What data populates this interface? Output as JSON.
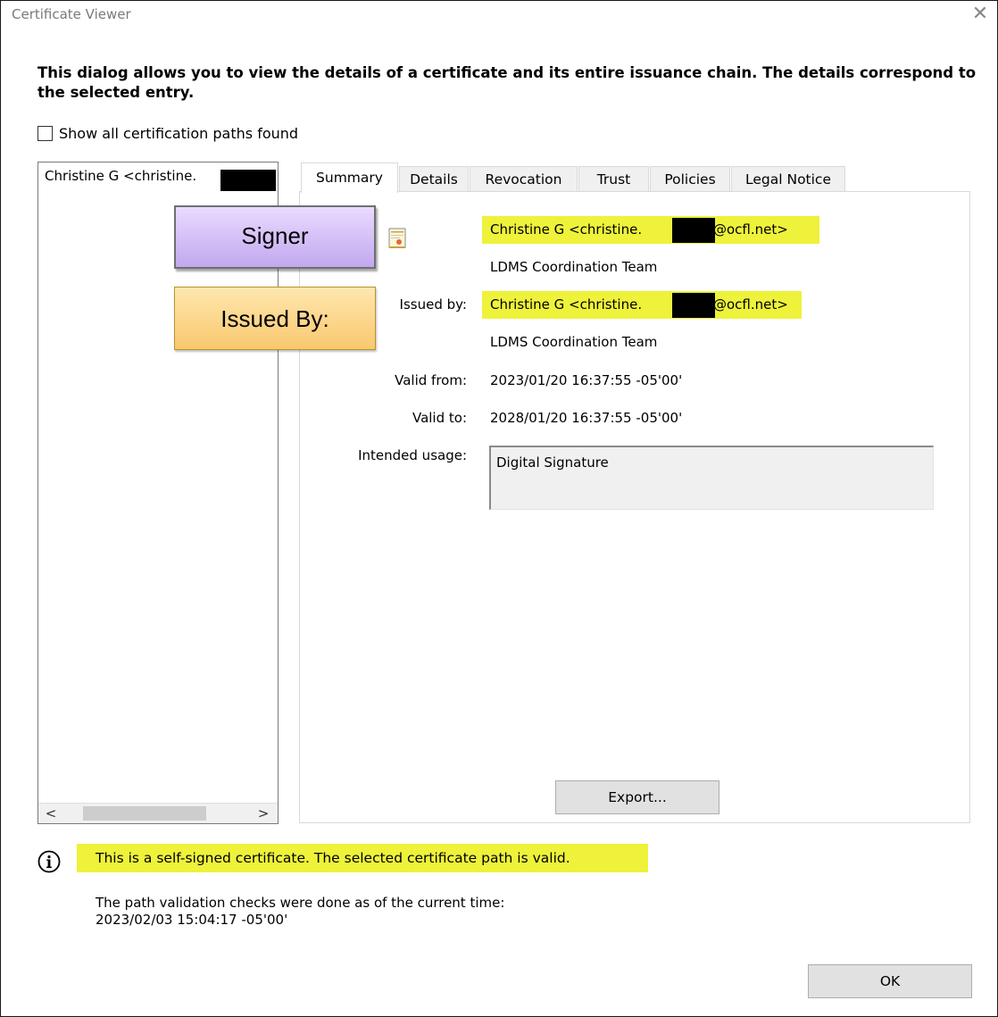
{
  "window": {
    "title": "Certificate Viewer",
    "close_glyph": "✕"
  },
  "intro": "This dialog allows you to view the details of a certificate and its entire issuance chain. The details correspond to the selected entry.",
  "show_all_paths": {
    "label": "Show all certification paths found",
    "checked": false
  },
  "chain": {
    "items": [
      {
        "label": "Christine G <christine."
      }
    ],
    "scroll_left": "<",
    "scroll_right": ">"
  },
  "tabs": [
    {
      "label": "Summary",
      "active": true
    },
    {
      "label": "Details",
      "active": false
    },
    {
      "label": "Revocation",
      "active": false
    },
    {
      "label": "Trust",
      "active": false
    },
    {
      "label": "Policies",
      "active": false
    },
    {
      "label": "Legal Notice",
      "active": false
    }
  ],
  "summary": {
    "subject_name_prefix": "Christine G <christine.",
    "subject_name_suffix": "@ocfl.net>",
    "subject_org": "LDMS Coordination Team",
    "issued_by_label": "Issued by:",
    "issuer_name_prefix": "Christine G <christine.",
    "issuer_name_suffix": "@ocfl.net>",
    "issuer_org": "LDMS Coordination Team",
    "valid_from_label": "Valid from:",
    "valid_from": "2023/01/20 16:37:55 -05'00'",
    "valid_to_label": "Valid to:",
    "valid_to": "2028/01/20 16:37:55 -05'00'",
    "intended_usage_label": "Intended usage:",
    "intended_usage": "Digital Signature",
    "export_label": "Export..."
  },
  "status": {
    "message": "This is a self-signed certificate. The selected certificate path is valid.",
    "check_note": "The path validation checks were done as of the current time:",
    "check_time": "2023/02/03 15:04:17 -05'00'"
  },
  "ok_label": "OK",
  "callouts": {
    "signer": "Signer",
    "issued_by": "Issued By:"
  },
  "colors": {
    "highlight": "#eef23a",
    "signer_callout": "#d6c4f7",
    "issued_callout": "#fbd58a"
  }
}
